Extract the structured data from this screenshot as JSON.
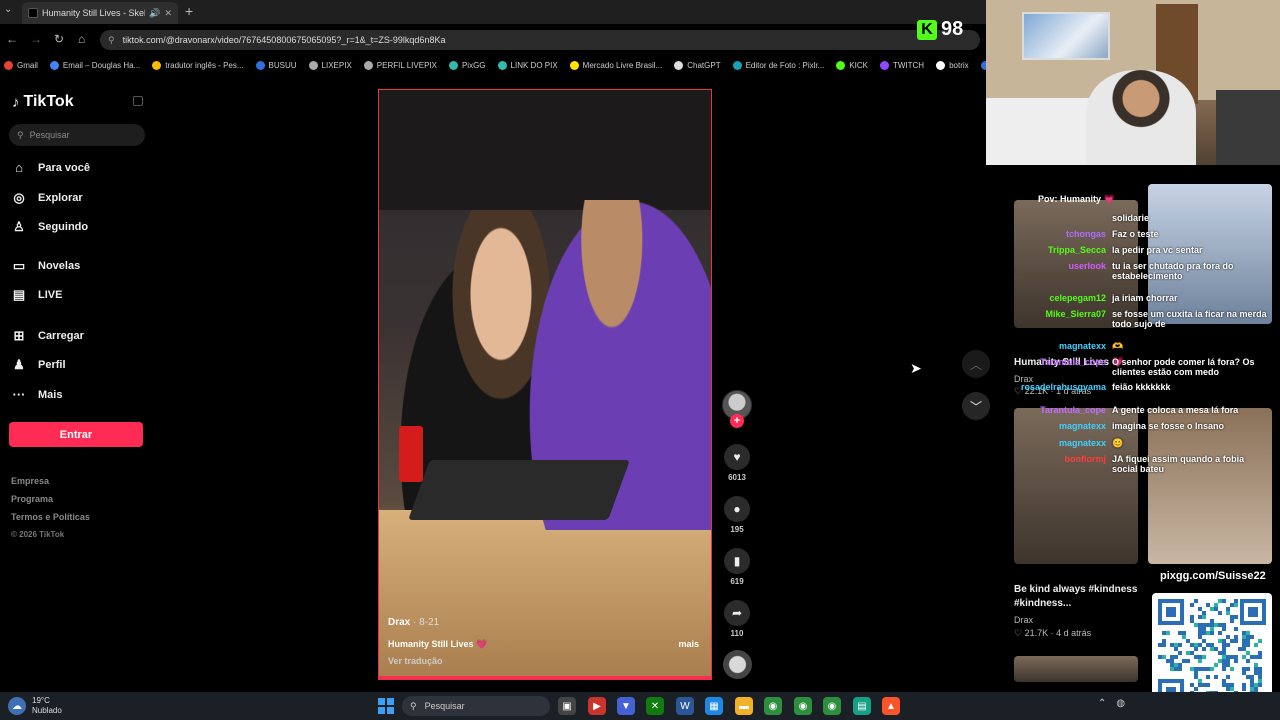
{
  "browser": {
    "tab_title": "Humanity Still Lives - Skeli",
    "url": "tiktok.com/@dravonarx/video/7676450800675065095?_r=1&_t=ZS-99lkqd6n8Ka",
    "bookmarks": [
      {
        "label": "Gmail",
        "color": "#ea4335"
      },
      {
        "label": "Email – Douglas Ha...",
        "color": "#4285f4"
      },
      {
        "label": "tradutor inglês - Pes...",
        "color": "#fbbc05"
      },
      {
        "label": "BUSUU",
        "color": "#2f6fdf"
      },
      {
        "label": "LIXEPIX",
        "color": "#aaaaaa"
      },
      {
        "label": "PERFIL LIVEPIX",
        "color": "#aaaaaa"
      },
      {
        "label": "PixGG",
        "color": "#32bcad"
      },
      {
        "label": "LINK DO PIX",
        "color": "#32bcad"
      },
      {
        "label": "Mercado Livre Brasil...",
        "color": "#ffe600"
      },
      {
        "label": "ChatGPT",
        "color": "#dddddd"
      },
      {
        "label": "Editor de Foto : Pixlr...",
        "color": "#17a2b8"
      },
      {
        "label": "KICK",
        "color": "#53fc18"
      },
      {
        "label": "TWITCH",
        "color": "#9146ff"
      },
      {
        "label": "botrix",
        "color": "#ffffff"
      },
      {
        "label": "Iníc",
        "color": "#2f6fdf"
      }
    ]
  },
  "kick": {
    "count": "98"
  },
  "tiktok": {
    "logo": "TikTok",
    "search_placeholder": "Pesquisar",
    "nav": [
      {
        "label": "Para você",
        "icon": "home-icon"
      },
      {
        "label": "Explorar",
        "icon": "compass-icon"
      },
      {
        "label": "Seguindo",
        "icon": "user-follow-icon"
      },
      {
        "label": "Novelas",
        "icon": "tv-icon"
      },
      {
        "label": "LIVE",
        "icon": "live-icon"
      },
      {
        "label": "Carregar",
        "icon": "plus-box-icon"
      },
      {
        "label": "Perfil",
        "icon": "person-icon"
      },
      {
        "label": "Mais",
        "icon": "more-icon"
      }
    ],
    "login": "Entrar",
    "footer": [
      "Empresa",
      "Programa",
      "Termos e Políticas"
    ],
    "copyright": "© 2026 TikTok"
  },
  "video": {
    "author": "Drax",
    "date": "· 8-21",
    "caption": "Humanity Still Lives 💗",
    "more": "mais",
    "translate": "Ver tradução",
    "progress": 1.0,
    "likes": "6013",
    "comments": "195",
    "saves": "619",
    "shares": "110"
  },
  "related": [
    {
      "title": "Humanity Still Lives 💗",
      "author": "Drax",
      "stats": "♡ 22.1K · 1 d atrás",
      "overlay": "Pov: Humanity 💗"
    },
    {
      "title": "Be kind always #kindness #kindness...",
      "author": "Drax",
      "stats": "♡ 21.7K · 4 d atrás"
    }
  ],
  "chat": [
    {
      "user": "",
      "msg": "solidarie",
      "color": "#ffffff"
    },
    {
      "user": "tchongas",
      "msg": "Faz o teste",
      "color": "#b06bff"
    },
    {
      "user": "Trippa_Secca",
      "msg": "la pedir pra vc sentar",
      "color": "#53fc18"
    },
    {
      "user": "userlook",
      "msg": "tu ia ser chutado pra fora do estabelecimento",
      "color": "#d15cff"
    },
    {
      "user": "celepegam12",
      "msg": "ja iriam chorrar",
      "color": "#53fc18"
    },
    {
      "user": "Mike_Sierra07",
      "msg": "se fosse um cuxita ia ficar na merda todo sujo de",
      "color": "#53fc18"
    },
    {
      "user": "magnatexx",
      "msg": "🫶",
      "color": "#3fd0ff"
    },
    {
      "user": "Tarantula_cope",
      "msg": "O senhor pode comer lá fora? Os clientes estão com medo",
      "color": "#c26bff"
    },
    {
      "user": "rosadelrahusgvama",
      "msg": "feião kkkkkkk",
      "color": "#3fd0ff"
    },
    {
      "user": "Tarantula_cope",
      "msg": "A gente coloca a mesa lá fora",
      "color": "#c26bff"
    },
    {
      "user": "magnatexx",
      "msg": "imagina se fosse o Insano",
      "color": "#3fd0ff"
    },
    {
      "user": "magnatexx",
      "msg": "😊",
      "color": "#3fd0ff"
    },
    {
      "user": "bonfiormj",
      "msg": "JA fiquei assim quando a fobia social bateu",
      "color": "#ff3b3b"
    }
  ],
  "pix": {
    "label": "pixgg.com/Suisse22"
  },
  "taskbar": {
    "temp": "19°C",
    "weather": "Nublado",
    "search": "Pesquisar"
  }
}
